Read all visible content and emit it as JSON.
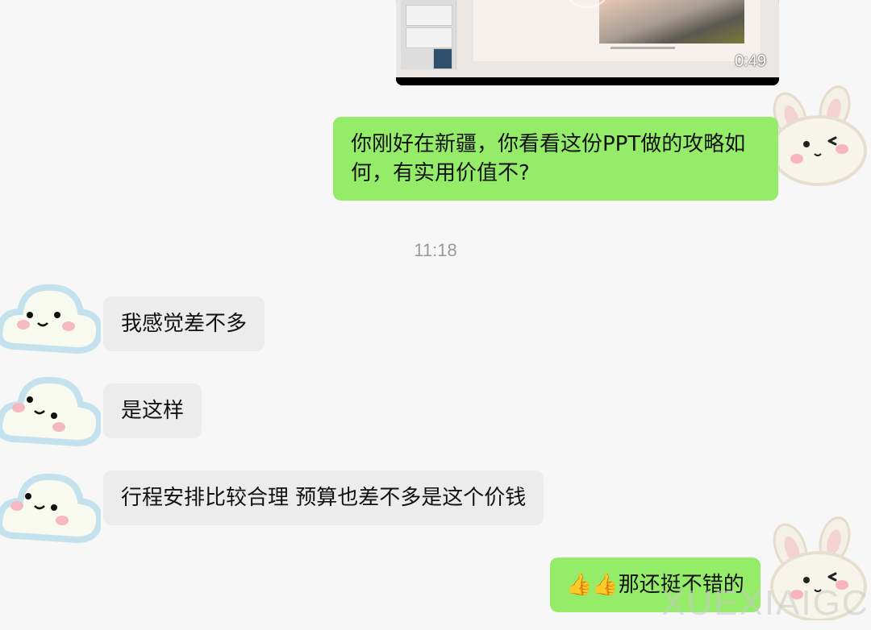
{
  "video": {
    "duration": "0:49"
  },
  "messages": [
    {
      "id": "m1",
      "side": "out",
      "text": "你刚好在新疆，你看看这份PPT做的攻略如何，有实用价值不?"
    },
    {
      "id": "m2",
      "side": "in",
      "text": "我感觉差不多"
    },
    {
      "id": "m3",
      "side": "in",
      "text": "是这样"
    },
    {
      "id": "m4",
      "side": "in",
      "text": "行程安排比较合理 预算也差不多是这个价钱"
    },
    {
      "id": "m5",
      "side": "out",
      "text": "👍👍那还挺不错的"
    }
  ],
  "timestamp": "11:18",
  "watermark": "XUEXIAIGC",
  "avatars": {
    "self": "rabbit-avatar",
    "other": "cloud-avatar"
  },
  "colors": {
    "outgoing_bubble": "#95ec69",
    "incoming_bubble": "#ececec",
    "background": "#f7f7f7"
  }
}
